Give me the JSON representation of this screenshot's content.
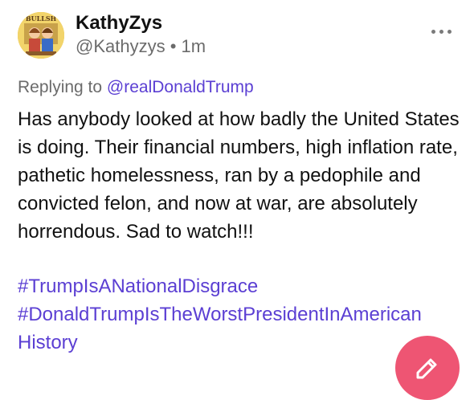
{
  "author": {
    "display_name": "KathyZys",
    "handle": "@Kathyzys",
    "separator": "•",
    "time_ago": "1m",
    "avatar_text": "BULLSH"
  },
  "reply": {
    "prefix": "Replying to ",
    "mention": "@realDonaldTrump"
  },
  "body": {
    "text": "Has anybody looked at how badly the United States is doing. Their financial numbers, high inflation rate, pathetic homelessness, ran by a pedophile and convicted felon, and now at war, are absolutely horrendous. Sad to watch!!!"
  },
  "hashtags": [
    "#TrumpIsANationalDisgrace",
    "#DonaldTrumpIsTheWorstPresidentInAmerican",
    "History"
  ],
  "colors": {
    "link": "#5b3fd3",
    "fab": "#ee5573",
    "muted": "#6b6b6b"
  },
  "icons": {
    "more": "more-horizontal-icon",
    "compose": "compose-pencil-icon"
  }
}
